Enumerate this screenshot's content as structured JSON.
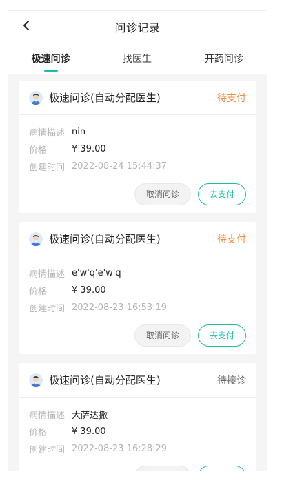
{
  "header": {
    "title": "问诊记录"
  },
  "tabs": [
    {
      "label": "极速问诊"
    },
    {
      "label": "找医生"
    },
    {
      "label": "开药问诊"
    }
  ],
  "labels": {
    "description": "病情描述",
    "price": "价格",
    "created": "创建时间"
  },
  "orders": [
    {
      "title": "极速问诊(自动分配医生)",
      "status": "待支付",
      "description": "nin",
      "price": "¥ 39.00",
      "created_at": "2022-08-24 15:44:37",
      "cancel_label": "取消问诊",
      "pay_label": "去支付"
    },
    {
      "title": "极速问诊(自动分配医生)",
      "status": "待支付",
      "description": "e'w'q'e'w'q",
      "price": "¥ 39.00",
      "created_at": "2022-08-23 16:53:19",
      "cancel_label": "取消问诊",
      "pay_label": "去支付"
    },
    {
      "title": "极速问诊(自动分配医生)",
      "status": "待接诊",
      "description": "大萨达撒",
      "price": "¥ 39.00",
      "created_at": "2022-08-23 16:28:29"
    }
  ],
  "colors": {
    "accent": "#1dbfa4",
    "status_pending_pay": "#f58b3f",
    "status_pending_accept": "#666666",
    "background": "#f5f5f5"
  }
}
